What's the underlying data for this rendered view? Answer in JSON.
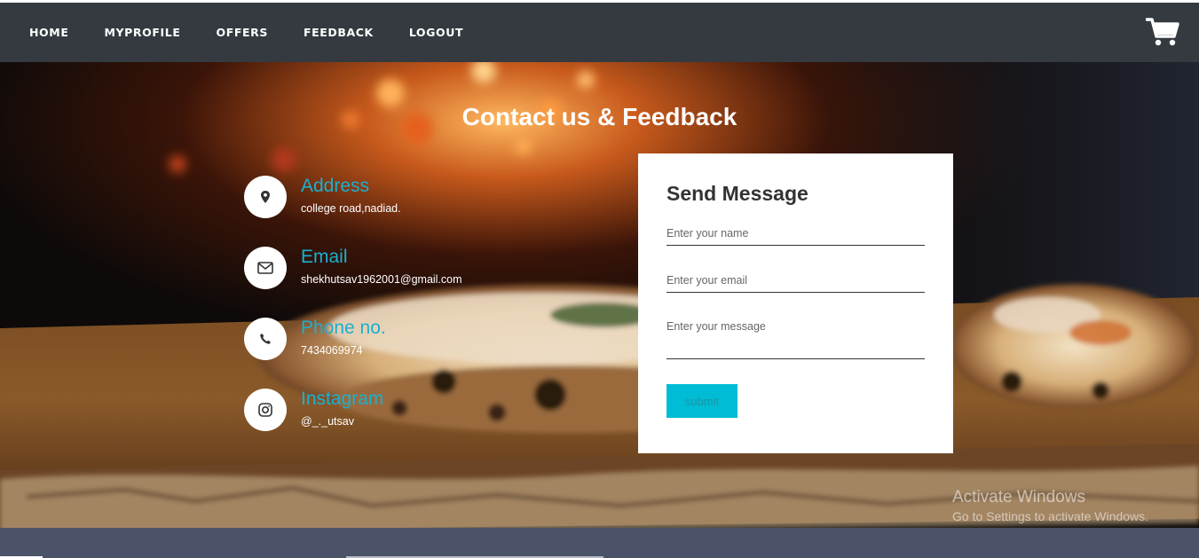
{
  "nav": {
    "links": [
      "HOME",
      "MYPROFILE",
      "OFFERS",
      "FEEDBACK",
      "LOGOUT"
    ],
    "cart_icon": "shopping-cart-icon"
  },
  "page": {
    "title": "Contact us & Feedback"
  },
  "contact": {
    "items": [
      {
        "icon": "map-pin-icon",
        "title": "Address",
        "value": "college road,nadiad."
      },
      {
        "icon": "envelope-icon",
        "title": "Email",
        "value": "shekhutsav1962001@gmail.com"
      },
      {
        "icon": "phone-icon",
        "title": "Phone no.",
        "value": "7434069974"
      },
      {
        "icon": "instagram-icon",
        "title": "Instagram",
        "value": "@_._utsav"
      }
    ]
  },
  "form": {
    "heading": "Send Message",
    "name_placeholder": "Enter your name",
    "email_placeholder": "Enter your email",
    "message_placeholder": "Enter your message",
    "submit_label": "submit"
  },
  "watermark": {
    "title": "Activate Windows",
    "subtitle": "Go to Settings to activate Windows."
  },
  "colors": {
    "navbar": "#343a40",
    "accent": "#1ab0d0",
    "submit": "#00bcd4"
  }
}
